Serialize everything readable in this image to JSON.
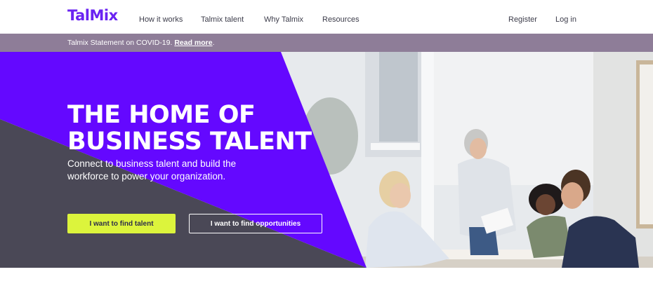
{
  "header": {
    "logo": "TalMix",
    "nav": {
      "how_it_works": "How it works",
      "talmix_talent": "Talmix talent",
      "why_talmix": "Why Talmix",
      "resources": "Resources",
      "register": "Register",
      "login": "Log in"
    }
  },
  "notice": {
    "text": "Talmix Statement on COVID-19.",
    "link": "Read more",
    "trailing": "."
  },
  "hero": {
    "title_line1": "THE HOME OF",
    "title_line2": "BUSINESS TALENT",
    "subtitle": "Connect to business talent and build the workforce to power your organization.",
    "buttons": {
      "find_talent": "I want to find talent",
      "find_opportunities": "I want to find opportunities"
    }
  },
  "colors": {
    "brand_purple": "#6a23f2",
    "hero_purple": "#6408ff",
    "hero_dark": "#4a4856",
    "notice_bar": "#8e7d98",
    "cta_yellow": "#dcf43c"
  },
  "icons": [
    "hero-photo"
  ]
}
